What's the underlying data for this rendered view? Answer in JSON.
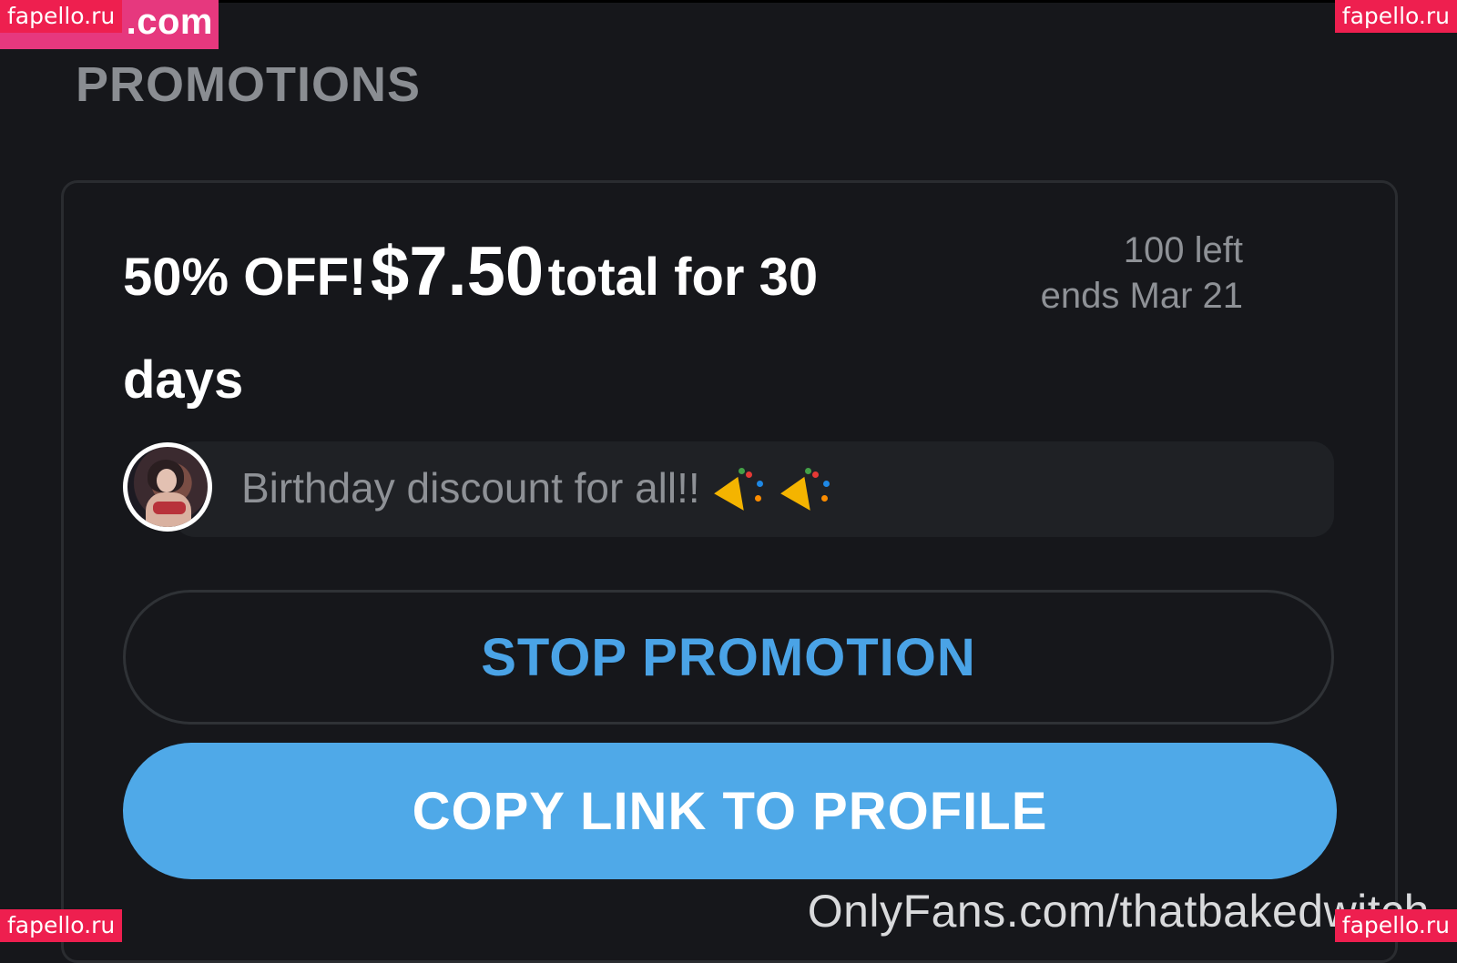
{
  "watermarks": {
    "brand_fragment": ".com",
    "site": "fapello.ru"
  },
  "section": {
    "title": "PROMOTIONS"
  },
  "promotion": {
    "discount_label": "50% OFF!",
    "price": "$7.50",
    "duration_part1": "total for 30",
    "duration_part2": "days",
    "remaining": "100 left",
    "ends": "ends Mar 21",
    "message": "Birthday discount for all!!",
    "message_emoji": "party-popper-icon"
  },
  "buttons": {
    "stop_label": "STOP PROMOTION",
    "copy_label": "COPY LINK TO PROFILE"
  },
  "footer": {
    "url": "OnlyFans.com/thatbakedwitch"
  },
  "colors": {
    "background": "#16171b",
    "accent_blue": "#4fa9e8",
    "watermark_red": "#ee1f4f"
  }
}
